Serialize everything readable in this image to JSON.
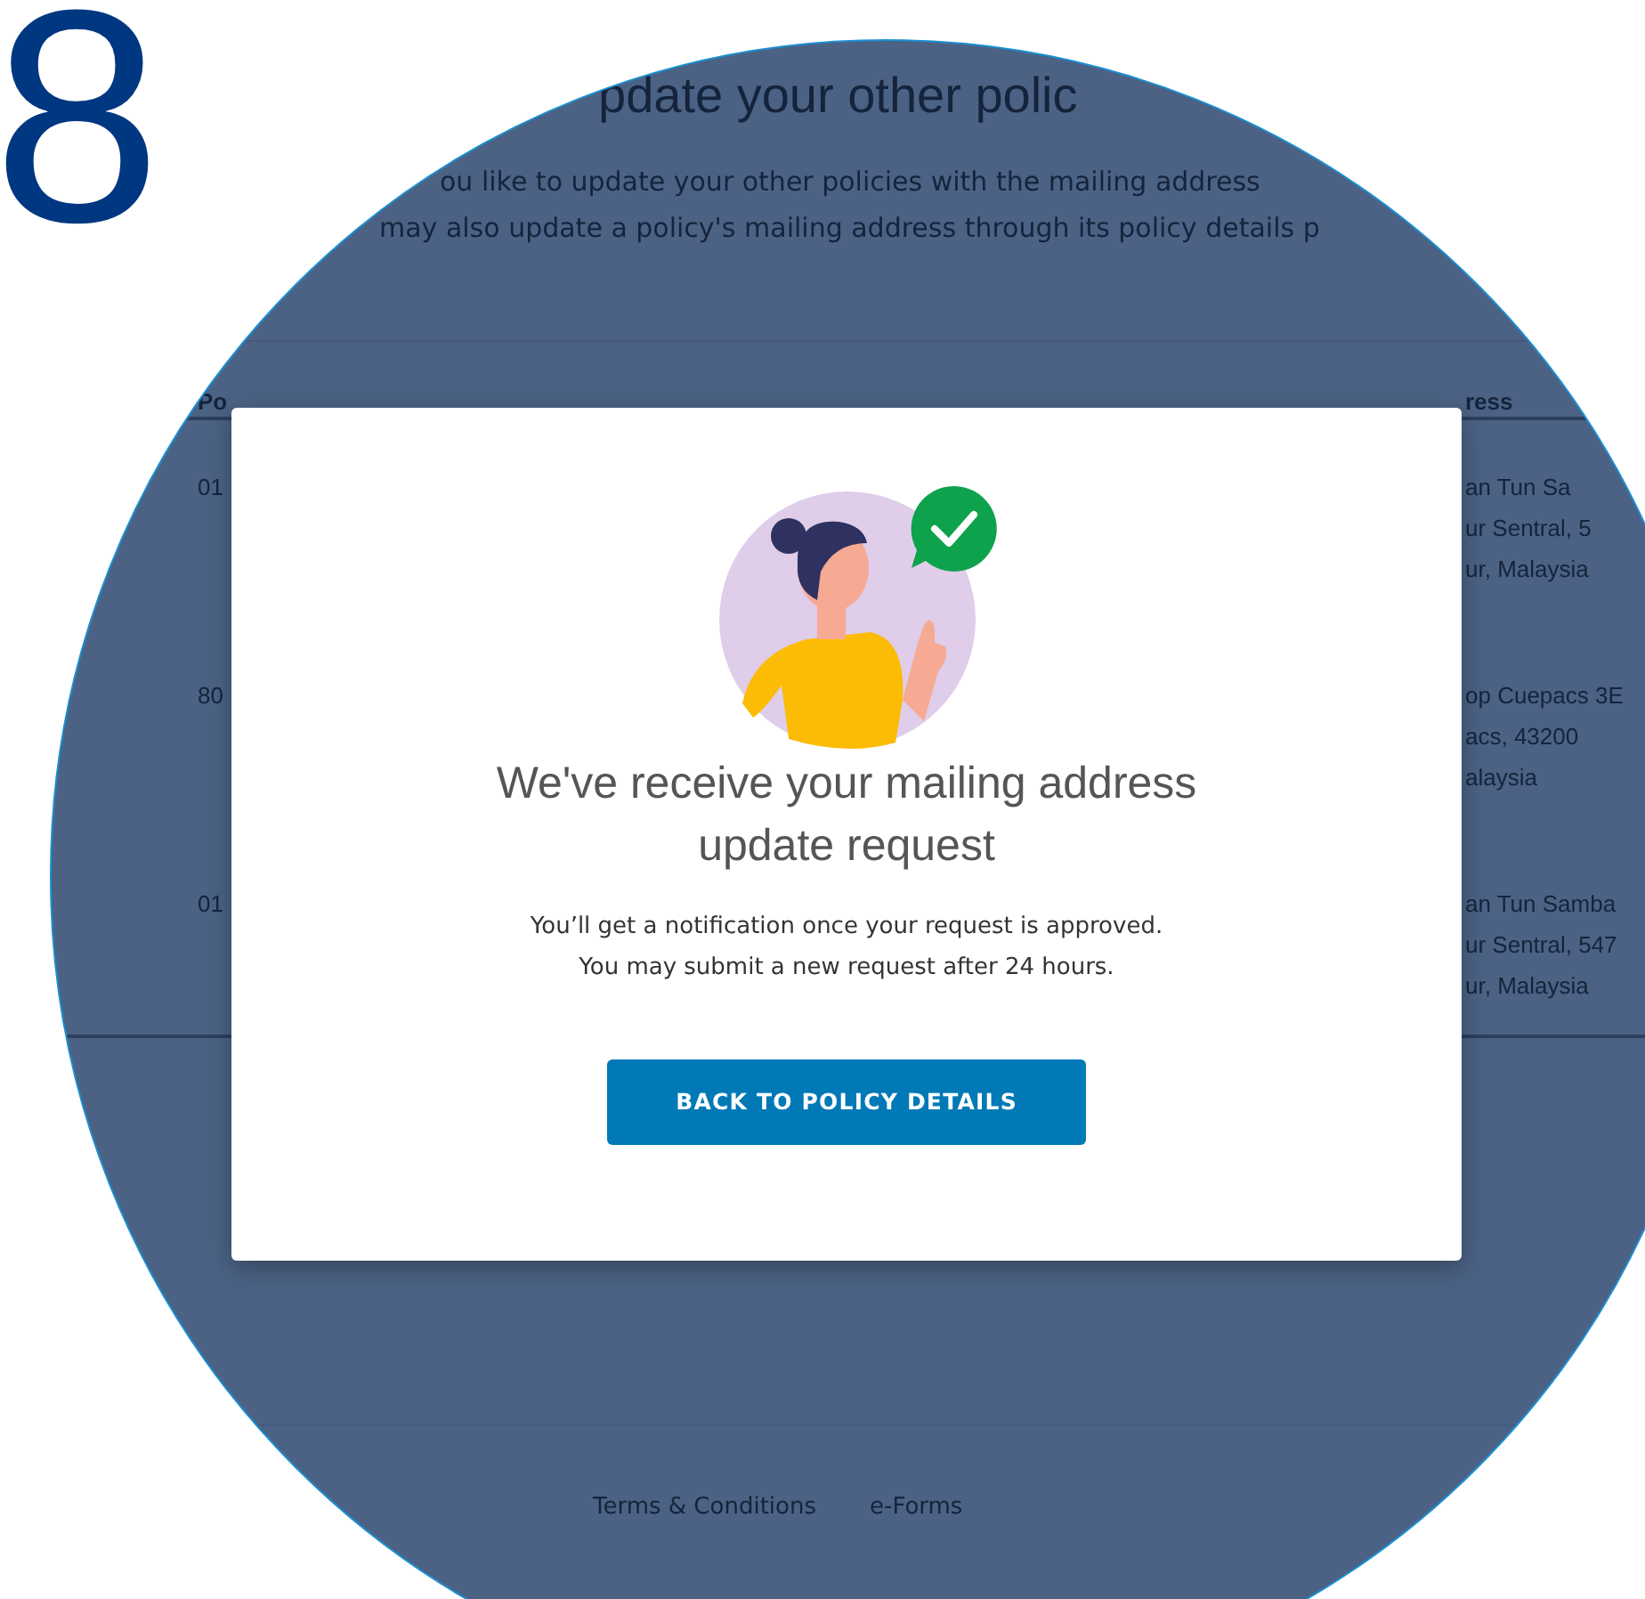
{
  "step_number": "8",
  "page": {
    "heading": "pdate your other polic",
    "description": [
      "ou like to update your other policies with the mailing address",
      "may also update a policy's mailing address through its policy details p"
    ],
    "table": {
      "columns": [
        "Po",
        "ress"
      ],
      "rows": [
        {
          "column_1": "01",
          "column_2": [
            "an Tun Sa",
            "ur Sentral, 5",
            "ur, Malaysia"
          ]
        },
        {
          "column_1": "80",
          "column_2": [
            "op Cuepacs 3E",
            "acs, 43200",
            "alaysia"
          ]
        },
        {
          "column_1": "01",
          "column_2": [
            "an Tun Samba",
            "ur Sentral, 547",
            "ur, Malaysia"
          ]
        }
      ]
    },
    "footer_links": [
      "Terms & Conditions",
      "e-Forms"
    ]
  },
  "modal": {
    "title": "We've receive your mailing address update request",
    "message": [
      "You’ll get a notification once your request is approved.",
      "You may submit a new request after 24 hours."
    ],
    "button": "BACK TO POLICY DETAILS"
  }
}
